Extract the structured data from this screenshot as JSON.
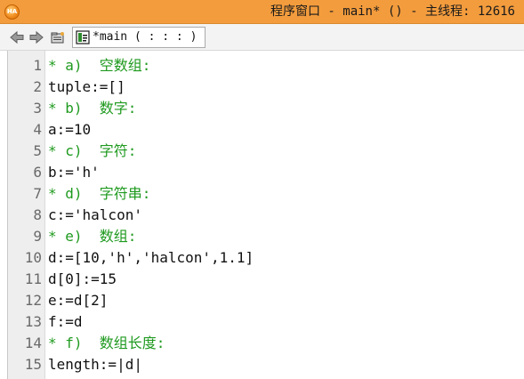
{
  "window": {
    "title": "程序窗口 - main* () - 主线程: 12616",
    "icon_text": "HA"
  },
  "toolbar": {
    "back_icon": "arrow-left-icon",
    "forward_icon": "arrow-right-icon",
    "folder_icon": "folder-open-icon",
    "tab_icon": "procedure-icon",
    "tab_label": "*main ( : : : )"
  },
  "colors": {
    "titlebar": "#f39c3d",
    "comment": "#1f9a1f",
    "code": "#111111",
    "line_number": "#6a6a6a",
    "gutter": "#eeeeee"
  },
  "editor": {
    "lines": [
      {
        "no": "1",
        "type": "comment",
        "text": "* a)  空数组:"
      },
      {
        "no": "2",
        "type": "code",
        "text": "tuple:=[]"
      },
      {
        "no": "3",
        "type": "comment",
        "text": "* b)  数字:"
      },
      {
        "no": "4",
        "type": "code",
        "text": "a:=10"
      },
      {
        "no": "5",
        "type": "comment",
        "text": "* c)  字符:"
      },
      {
        "no": "6",
        "type": "code",
        "text": "b:='h'"
      },
      {
        "no": "7",
        "type": "comment",
        "text": "* d)  字符串:"
      },
      {
        "no": "8",
        "type": "code",
        "text": "c:='halcon'"
      },
      {
        "no": "9",
        "type": "comment",
        "text": "* e)  数组:"
      },
      {
        "no": "10",
        "type": "code",
        "text": "d:=[10,'h','halcon',1.1]"
      },
      {
        "no": "11",
        "type": "code",
        "text": "d[0]:=15"
      },
      {
        "no": "12",
        "type": "code",
        "text": "e:=d[2]"
      },
      {
        "no": "13",
        "type": "code",
        "text": "f:=d"
      },
      {
        "no": "14",
        "type": "comment",
        "text": "* f)  数组长度:"
      },
      {
        "no": "15",
        "type": "code",
        "text": "length:=|d|"
      }
    ]
  }
}
